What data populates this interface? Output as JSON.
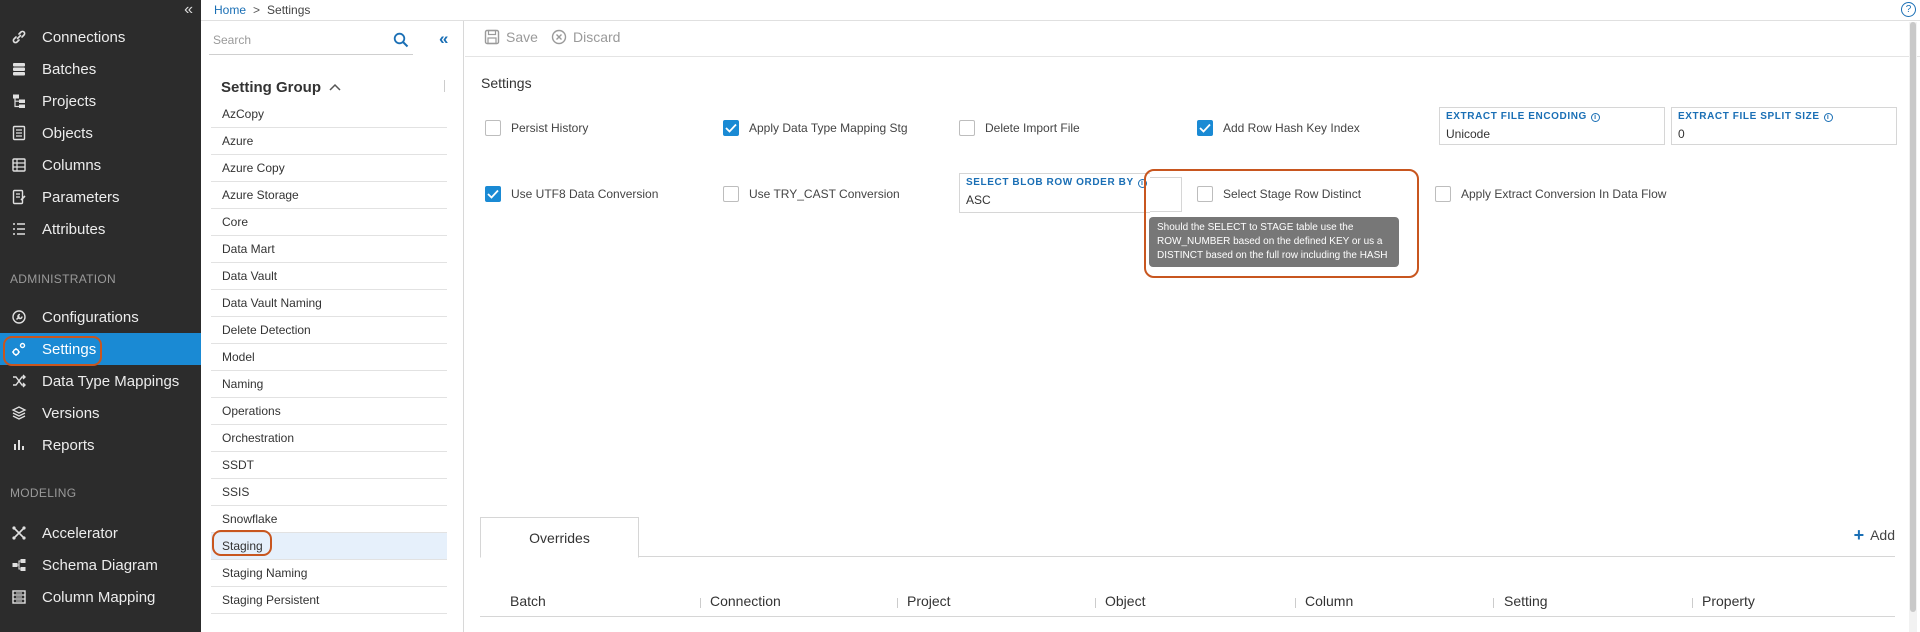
{
  "nav": {
    "items": [
      {
        "label": "Connections",
        "icon": "link-icon"
      },
      {
        "label": "Batches",
        "icon": "stack-icon"
      },
      {
        "label": "Projects",
        "icon": "hierarchy-icon"
      },
      {
        "label": "Objects",
        "icon": "document-icon"
      },
      {
        "label": "Columns",
        "icon": "columns-icon"
      },
      {
        "label": "Parameters",
        "icon": "parameters-icon"
      },
      {
        "label": "Attributes",
        "icon": "list-icon"
      }
    ],
    "admin_section": "ADMINISTRATION",
    "admin_items": [
      {
        "label": "Configurations",
        "icon": "wrench-icon"
      },
      {
        "label": "Settings",
        "icon": "gears-icon"
      },
      {
        "label": "Data Type Mappings",
        "icon": "shuffle-icon"
      },
      {
        "label": "Versions",
        "icon": "layers-icon"
      },
      {
        "label": "Reports",
        "icon": "bar-chart-icon"
      }
    ],
    "modeling_section": "MODELING",
    "modeling_items": [
      {
        "label": "Accelerator",
        "icon": "accelerator-icon"
      },
      {
        "label": "Schema Diagram",
        "icon": "diagram-icon"
      },
      {
        "label": "Column Mapping",
        "icon": "mapping-icon"
      }
    ],
    "active": "Settings"
  },
  "breadcrumb": {
    "home": "Home",
    "separator": ">",
    "current": "Settings"
  },
  "group_panel": {
    "search_placeholder": "Search",
    "header": "Setting Group",
    "items": [
      "AzCopy",
      "Azure",
      "Azure Copy",
      "Azure Storage",
      "Core",
      "Data Mart",
      "Data Vault",
      "Data Vault Naming",
      "Delete Detection",
      "Model",
      "Naming",
      "Operations",
      "Orchestration",
      "SSDT",
      "SSIS",
      "Snowflake",
      "Staging",
      "Staging Naming",
      "Staging Persistent"
    ],
    "selected": "Staging"
  },
  "toolbar": {
    "save_label": "Save",
    "discard_label": "Discard"
  },
  "settings": {
    "title": "Settings",
    "checkboxes": [
      {
        "label": "Persist History",
        "checked": false
      },
      {
        "label": "Apply Data Type Mapping Stg",
        "checked": true
      },
      {
        "label": "Delete Import File",
        "checked": false
      },
      {
        "label": "Add Row Hash Key Index",
        "checked": true
      },
      {
        "label": "Use UTF8 Data Conversion",
        "checked": true
      },
      {
        "label": "Use TRY_CAST Conversion",
        "checked": false
      },
      {
        "label": "Select Stage Row Distinct",
        "checked": false
      },
      {
        "label": "Apply Extract Conversion In Data Flow",
        "checked": false
      }
    ],
    "fields": {
      "extract_encoding": {
        "label": "EXTRACT FILE ENCODING",
        "value": "Unicode"
      },
      "extract_split_size": {
        "label": "EXTRACT FILE SPLIT SIZE",
        "value": "0"
      },
      "blob_row_order": {
        "label": "SELECT BLOB ROW ORDER BY",
        "value": "ASC"
      }
    },
    "tooltip": "Should the SELECT to STAGE table use the ROW_NUMBER based on the defined KEY or us a DISTINCT based on the full row including the HASH"
  },
  "overrides": {
    "tab_label": "Overrides",
    "add_label": "Add",
    "columns": [
      "Batch",
      "Connection",
      "Project",
      "Object",
      "Column",
      "Setting",
      "Property"
    ]
  },
  "colors": {
    "nav_bg": "#2c2c2c",
    "accent": "#1a8ad4",
    "link": "#1a6fb5",
    "highlight": "#c8561f"
  }
}
